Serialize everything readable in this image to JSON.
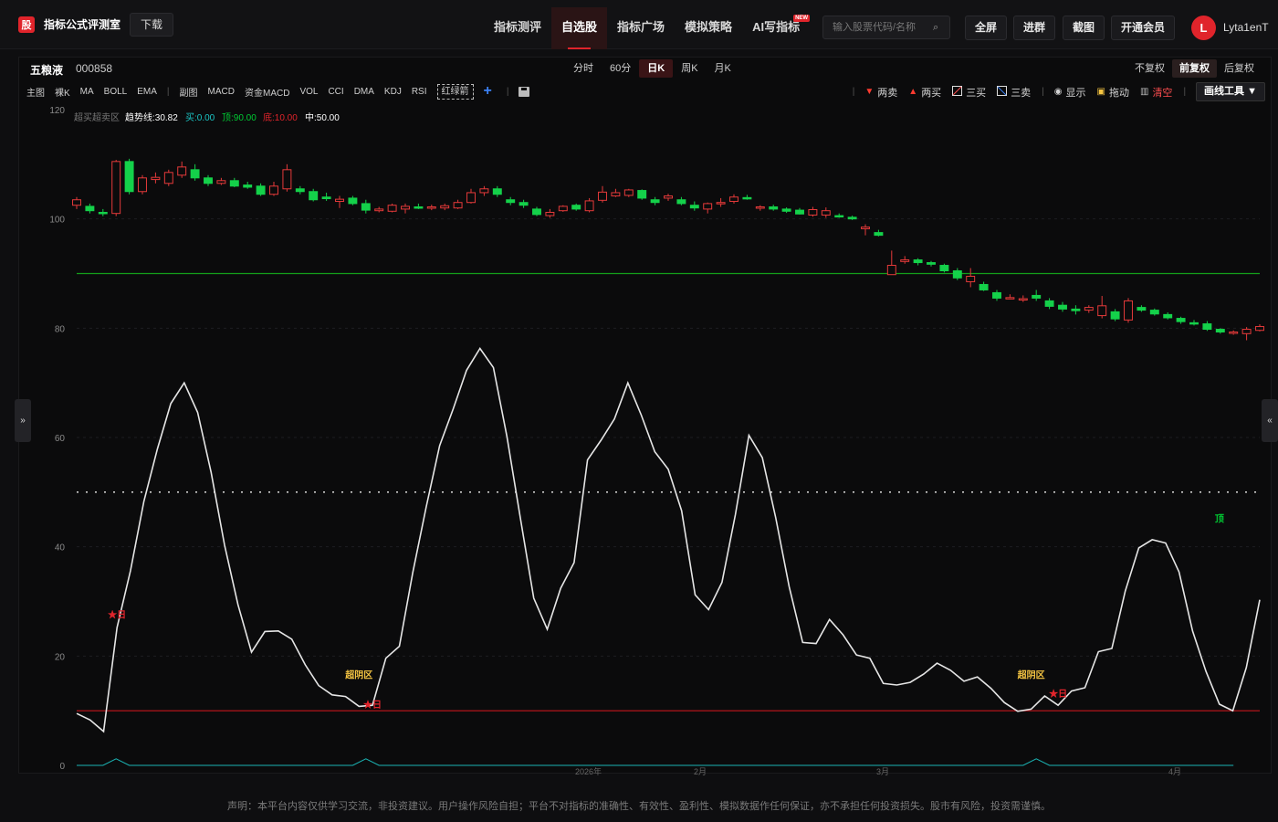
{
  "app": {
    "logo_text": "股",
    "name": "指标公式评测室",
    "download": "下载"
  },
  "nav": [
    {
      "label": "指标测评"
    },
    {
      "label": "自选股",
      "active": true
    },
    {
      "label": "指标广场"
    },
    {
      "label": "模拟策略"
    },
    {
      "label": "AI写指标",
      "badge": "NEW"
    }
  ],
  "search": {
    "placeholder": "输入股票代码/名称"
  },
  "top_buttons": [
    "全屏",
    "进群",
    "截图",
    "开通会员"
  ],
  "user": {
    "initial": "L",
    "name": "Lyta1enT"
  },
  "stock": {
    "name": "五粮液",
    "code": "000858"
  },
  "period_tabs": [
    {
      "label": "分时"
    },
    {
      "label": "60分"
    },
    {
      "label": "日K",
      "active": true
    },
    {
      "label": "周K"
    },
    {
      "label": "月K"
    }
  ],
  "fq_tabs": [
    {
      "label": "不复权"
    },
    {
      "label": "前复权",
      "active": true
    },
    {
      "label": "后复权"
    }
  ],
  "indicators_main": [
    "主图",
    "裸K",
    "MA",
    "BOLL",
    "EMA"
  ],
  "indicators_sub": [
    "副图",
    "MACD",
    "资金MACD",
    "VOL",
    "CCI",
    "DMA",
    "KDJ",
    "RSI"
  ],
  "indicator_active": "红绿箭",
  "tools": [
    {
      "icon": "down-triangle",
      "label": "两卖",
      "icon_color": "#ff3b30"
    },
    {
      "icon": "up-triangle",
      "label": "两买",
      "icon_color": "#ff3b30"
    },
    {
      "icon": "line-icon",
      "label": "三买",
      "icon_color": "#ddd"
    },
    {
      "icon": "line-icon",
      "label": "三卖",
      "icon_color": "#ddd"
    },
    {
      "icon": "eye-icon",
      "label": "显示",
      "icon_color": "#ddd"
    },
    {
      "icon": "lock-icon",
      "label": "拖动",
      "icon_color": "#f5c542"
    },
    {
      "icon": "trash-icon",
      "label": "清空",
      "icon_color": "#bbb",
      "label_color": "#ff4d4f"
    }
  ],
  "draw_tool": "画线工具 ▼",
  "legend": {
    "name": "超买超卖区",
    "items": [
      {
        "label": "趋势线:30.82",
        "color": "#ffffff"
      },
      {
        "label": "买:0.00",
        "color": "#1bc5c5"
      },
      {
        "label": "顶:90.00",
        "color": "#00cc33"
      },
      {
        "label": "底:10.00",
        "color": "#e0242b"
      },
      {
        "label": "中:50.00",
        "color": "#ffffff"
      }
    ]
  },
  "chart_data": {
    "type": "candlestick+line",
    "ylim": [
      0,
      120
    ],
    "y_ticks": [
      0,
      20,
      40,
      60,
      80,
      100,
      120
    ],
    "x_tick_labels": [
      "2026年",
      "2月",
      "3月",
      "4月"
    ],
    "levels": {
      "top": 90,
      "middle": 50,
      "bottom": 10
    },
    "candles": [
      [
        102.5,
        103.5,
        104.0,
        101.8
      ],
      [
        102.3,
        101.5,
        102.8,
        101.0
      ],
      [
        101.2,
        101.0,
        101.8,
        100.5
      ],
      [
        101.0,
        110.5,
        110.8,
        100.5
      ],
      [
        110.5,
        105.0,
        111.0,
        104.5
      ],
      [
        105.0,
        107.5,
        108.0,
        104.5
      ],
      [
        107.2,
        107.6,
        108.5,
        106.5
      ],
      [
        106.5,
        108.5,
        109.0,
        106.0
      ],
      [
        108.0,
        109.5,
        110.5,
        107.5
      ],
      [
        109.0,
        107.5,
        110.0,
        107.0
      ],
      [
        107.5,
        106.5,
        108.0,
        106.0
      ],
      [
        106.5,
        107.0,
        107.5,
        106.2
      ],
      [
        107.0,
        106.0,
        107.5,
        105.8
      ],
      [
        106.2,
        105.8,
        106.8,
        105.5
      ],
      [
        106.0,
        104.5,
        106.5,
        104.2
      ],
      [
        104.5,
        106.0,
        106.8,
        104.2
      ],
      [
        105.5,
        109.0,
        110.0,
        105.0
      ],
      [
        105.5,
        105.0,
        106.0,
        104.5
      ],
      [
        105.0,
        103.5,
        105.5,
        103.2
      ],
      [
        104.0,
        103.7,
        104.8,
        103.3
      ],
      [
        103.2,
        103.6,
        104.2,
        102.0
      ],
      [
        103.8,
        102.8,
        104.2,
        102.5
      ],
      [
        102.8,
        101.6,
        103.5,
        101.0
      ],
      [
        101.5,
        101.8,
        102.2,
        101.2
      ],
      [
        101.4,
        102.5,
        102.8,
        101.2
      ],
      [
        101.8,
        102.3,
        102.8,
        101.0
      ],
      [
        102.2,
        102.0,
        102.8,
        101.8
      ],
      [
        102.0,
        102.2,
        102.6,
        101.6
      ],
      [
        102.0,
        102.4,
        102.8,
        101.6
      ],
      [
        102.0,
        103.0,
        103.5,
        101.8
      ],
      [
        103.0,
        104.8,
        105.5,
        102.8
      ],
      [
        104.8,
        105.5,
        106.0,
        104.2
      ],
      [
        105.5,
        104.5,
        106.0,
        104.0
      ],
      [
        103.5,
        103.0,
        104.0,
        102.5
      ],
      [
        103.0,
        102.5,
        103.5,
        102.0
      ],
      [
        101.8,
        100.8,
        102.2,
        100.5
      ],
      [
        100.6,
        101.2,
        101.8,
        100.2
      ],
      [
        101.5,
        102.3,
        102.5,
        101.3
      ],
      [
        102.5,
        101.8,
        102.8,
        101.5
      ],
      [
        101.5,
        103.3,
        103.8,
        101.2
      ],
      [
        103.4,
        104.9,
        106.0,
        103.0
      ],
      [
        104.2,
        104.8,
        105.5,
        104.0
      ],
      [
        104.3,
        105.3,
        105.5,
        104.0
      ],
      [
        105.2,
        103.8,
        105.4,
        103.5
      ],
      [
        103.5,
        103.0,
        104.0,
        102.5
      ],
      [
        103.8,
        104.2,
        104.6,
        103.3
      ],
      [
        103.5,
        102.8,
        104.0,
        102.5
      ],
      [
        102.5,
        102.0,
        103.2,
        101.5
      ],
      [
        101.8,
        102.8,
        103.0,
        101.0
      ],
      [
        102.8,
        103.0,
        103.8,
        102.2
      ],
      [
        103.2,
        104.0,
        104.5,
        102.8
      ],
      [
        103.9,
        103.7,
        104.4,
        103.5
      ],
      [
        102.0,
        102.2,
        102.5,
        101.5
      ],
      [
        102.2,
        101.8,
        102.6,
        101.5
      ],
      [
        101.8,
        101.4,
        102.1,
        101.1
      ],
      [
        101.6,
        100.9,
        102.0,
        100.8
      ],
      [
        100.7,
        101.7,
        102.2,
        100.4
      ],
      [
        100.7,
        101.5,
        102.1,
        100.2
      ],
      [
        100.6,
        100.5,
        101.0,
        100.2
      ],
      [
        100.3,
        100.0,
        100.6,
        99.8
      ],
      [
        98.2,
        98.5,
        99.0,
        97.0
      ],
      [
        97.5,
        97.0,
        98.0,
        96.8
      ],
      [
        89.8,
        91.5,
        94.2,
        89.8
      ],
      [
        92.2,
        92.5,
        93.2,
        91.8
      ],
      [
        92.5,
        92.0,
        92.8,
        91.5
      ],
      [
        92.0,
        91.7,
        92.3,
        91.3
      ],
      [
        91.5,
        90.5,
        91.8,
        90.2
      ],
      [
        90.5,
        89.2,
        91.0,
        88.8
      ],
      [
        88.5,
        89.5,
        91.0,
        87.5
      ],
      [
        88.0,
        87.0,
        88.5,
        86.8
      ],
      [
        86.5,
        85.5,
        87.0,
        85.0
      ],
      [
        85.5,
        85.6,
        86.2,
        85.3
      ],
      [
        85.2,
        85.4,
        86.0,
        84.8
      ],
      [
        86.0,
        85.5,
        87.0,
        85.0
      ],
      [
        85.0,
        84.0,
        85.5,
        83.5
      ],
      [
        84.2,
        83.5,
        84.8,
        83.0
      ],
      [
        83.5,
        83.2,
        84.2,
        82.5
      ],
      [
        83.3,
        83.8,
        84.2,
        82.8
      ],
      [
        82.3,
        84.1,
        85.9,
        81.8
      ],
      [
        83.0,
        81.7,
        83.5,
        81.3
      ],
      [
        81.5,
        85.0,
        85.5,
        81.0
      ],
      [
        83.8,
        83.3,
        84.2,
        83.0
      ],
      [
        83.3,
        82.6,
        83.6,
        82.3
      ],
      [
        82.5,
        81.9,
        82.9,
        81.6
      ],
      [
        81.8,
        81.2,
        82.1,
        80.8
      ],
      [
        81.0,
        80.8,
        81.5,
        80.5
      ],
      [
        80.8,
        79.8,
        81.3,
        79.5
      ],
      [
        79.8,
        79.3,
        80.0,
        79.0
      ],
      [
        79.2,
        79.3,
        79.6,
        78.8
      ],
      [
        79.0,
        79.8,
        80.2,
        77.8
      ],
      [
        79.6,
        80.3,
        80.7,
        79.4
      ]
    ],
    "trend_line": [
      9.5,
      8.3,
      6.2,
      25.2,
      35.6,
      48.3,
      57.9,
      66.2,
      70.0,
      64.6,
      53.6,
      40.3,
      29.4,
      20.7,
      24.5,
      24.6,
      23.1,
      18.4,
      14.6,
      12.9,
      12.6,
      10.8,
      11.0,
      19.6,
      21.8,
      35.3,
      47.3,
      58.5,
      65.2,
      72.3,
      76.3,
      72.8,
      60.2,
      45.3,
      30.6,
      24.9,
      32.4,
      37.1,
      55.9,
      59.5,
      63.4,
      70.0,
      64.1,
      57.4,
      54.2,
      46.6,
      31.2,
      28.5,
      33.5,
      45.9,
      60.4,
      56.3,
      45.3,
      32.7,
      22.5,
      22.3,
      26.7,
      23.9,
      20.2,
      19.6,
      15.0,
      14.7,
      15.2,
      16.7,
      18.7,
      17.4,
      15.4,
      16.2,
      14.1,
      11.5,
      9.9,
      10.3,
      12.7,
      11.0,
      13.6,
      14.2,
      20.8,
      21.4,
      31.9,
      39.8,
      41.3,
      40.7,
      35.4,
      24.6,
      17.2,
      11.2,
      10.0,
      17.9,
      30.3
    ],
    "buy_signal": [
      0,
      0,
      0,
      1,
      0,
      0,
      0,
      0,
      0,
      0,
      0,
      0,
      0,
      0,
      0,
      0,
      0,
      0,
      0,
      0,
      0,
      0,
      1,
      0,
      0,
      0,
      0,
      0,
      0,
      0,
      0,
      0,
      0,
      0,
      0,
      0,
      0,
      0,
      0,
      0,
      0,
      0,
      0,
      0,
      0,
      0,
      0,
      0,
      0,
      0,
      0,
      0,
      0,
      0,
      0,
      0,
      0,
      0,
      0,
      0,
      0,
      0,
      0,
      0,
      0,
      0,
      0,
      0,
      0,
      0,
      0,
      0,
      0,
      1,
      0,
      0,
      0,
      0,
      0,
      0,
      0,
      0,
      0,
      0,
      0,
      0,
      0,
      0,
      0
    ],
    "markers": [
      {
        "text": "★日",
        "x_index": 3,
        "y": 27,
        "color": "#e0242b"
      },
      {
        "text": "★日",
        "x_index": 22,
        "y": 10.5,
        "color": "#e0242b"
      },
      {
        "text": "★日",
        "x_index": 73,
        "y": 12.5,
        "color": "#e0242b"
      },
      {
        "text": "超阴区",
        "x_index": 21,
        "y": 16,
        "color": "#f5c542"
      },
      {
        "text": "超阴区",
        "x_index": 71,
        "y": 16,
        "color": "#f5c542"
      },
      {
        "text": "顶",
        "x_index": 85,
        "y": 44.5,
        "color": "#00cc33"
      }
    ]
  },
  "disclaimer": "声明：本平台内容仅供学习交流，非投资建议。用户操作风险自担；平台不对指标的准确性、有效性、盈利性、模拟数据作任何保证，亦不承担任何投资损失。股市有风险，投资需谨慎。"
}
